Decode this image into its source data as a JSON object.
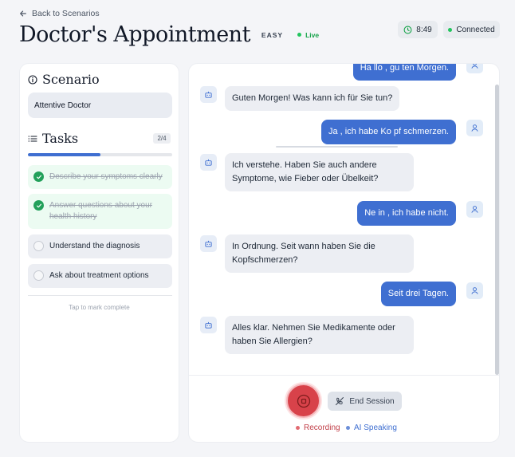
{
  "header": {
    "back_label": "Back to Scenarios",
    "title": "Doctor's Appointment",
    "difficulty": "EASY",
    "live_label": "Live",
    "timer": "8:49",
    "connection": "Connected"
  },
  "sidebar": {
    "scenario_heading": "Scenario",
    "role": "Attentive Doctor",
    "tasks_heading": "Tasks",
    "task_count": "2/4",
    "progress_fraction": 0.5,
    "tasks": [
      {
        "label": "Describe your symptoms clearly",
        "done": true
      },
      {
        "label": "Answer questions about your health history",
        "done": true
      },
      {
        "label": "Understand the diagnosis",
        "done": false
      },
      {
        "label": "Ask about treatment options",
        "done": false
      }
    ],
    "hint": "Tap to mark complete"
  },
  "chat": {
    "messages": [
      {
        "role": "user",
        "text": "Ha llo , gu ten Morgen."
      },
      {
        "role": "bot",
        "text": "Guten Morgen! Was kann ich für Sie tun?"
      },
      {
        "role": "user",
        "text": "Ja , ich habe Ko pf schmerzen."
      },
      {
        "role": "bot",
        "text": "Ich verstehe. Haben Sie auch andere Symptome, wie Fieber oder Übelkeit?"
      },
      {
        "role": "user",
        "text": "Ne in , ich habe nicht."
      },
      {
        "role": "bot",
        "text": "In Ordnung. Seit wann haben Sie die Kopfschmerzen?"
      },
      {
        "role": "user",
        "text": "Seit drei Tagen."
      },
      {
        "role": "bot",
        "text": "Alles klar. Nehmen Sie Medikamente oder haben Sie Allergien?"
      }
    ]
  },
  "controls": {
    "end_session_label": "End Session",
    "recording_label": "Recording",
    "ai_speaking_label": "AI Speaking"
  },
  "colors": {
    "accent": "#3f6fd1",
    "live": "#16a34a",
    "recording": "#d8424a",
    "done": "#22a05a"
  }
}
